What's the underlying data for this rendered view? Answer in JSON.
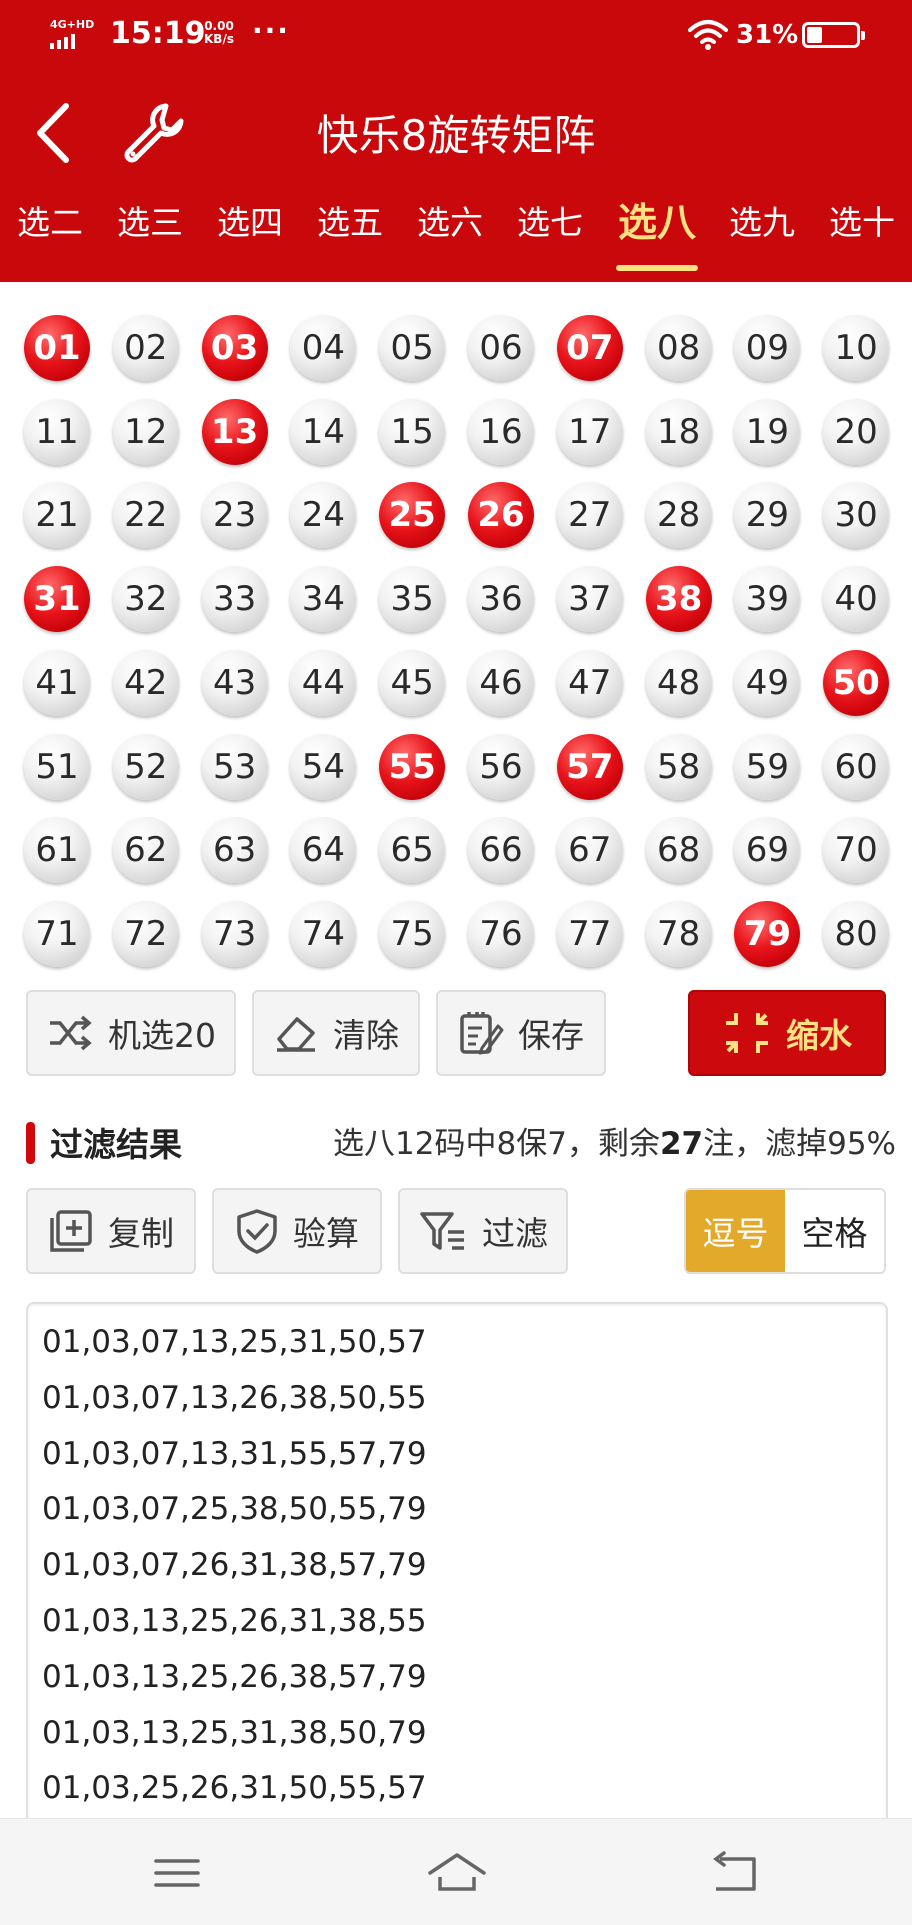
{
  "status_bar": {
    "network": "4G+HD",
    "time": "15:19",
    "speed_value": "0.00",
    "speed_unit": "KB/s",
    "more": "···",
    "battery": "31%",
    "battery_level": 0.31
  },
  "header": {
    "title": "快乐8旋转矩阵",
    "icons": [
      "back-arrow-icon",
      "wrench-icon"
    ]
  },
  "tabs": [
    {
      "label": "选二",
      "active": false
    },
    {
      "label": "选三",
      "active": false
    },
    {
      "label": "选四",
      "active": false
    },
    {
      "label": "选五",
      "active": false
    },
    {
      "label": "选六",
      "active": false
    },
    {
      "label": "选七",
      "active": false
    },
    {
      "label": "选八",
      "active": true
    },
    {
      "label": "选九",
      "active": false
    },
    {
      "label": "选十",
      "active": false
    }
  ],
  "balls": [
    "01",
    "02",
    "03",
    "04",
    "05",
    "06",
    "07",
    "08",
    "09",
    "10",
    "11",
    "12",
    "13",
    "14",
    "15",
    "16",
    "17",
    "18",
    "19",
    "20",
    "21",
    "22",
    "23",
    "24",
    "25",
    "26",
    "27",
    "28",
    "29",
    "30",
    "31",
    "32",
    "33",
    "34",
    "35",
    "36",
    "37",
    "38",
    "39",
    "40",
    "41",
    "42",
    "43",
    "44",
    "45",
    "46",
    "47",
    "48",
    "49",
    "50",
    "51",
    "52",
    "53",
    "54",
    "55",
    "56",
    "57",
    "58",
    "59",
    "60",
    "61",
    "62",
    "63",
    "64",
    "65",
    "66",
    "67",
    "68",
    "69",
    "70",
    "71",
    "72",
    "73",
    "74",
    "75",
    "76",
    "77",
    "78",
    "79",
    "80"
  ],
  "selected": [
    "01",
    "03",
    "07",
    "13",
    "25",
    "26",
    "31",
    "38",
    "50",
    "55",
    "57",
    "79"
  ],
  "actions": {
    "random": "机选20",
    "clear": "清除",
    "save": "保存",
    "shrink": "缩水"
  },
  "result": {
    "title": "过滤结果",
    "summary_prefix": "选八12码中8保7，剩余",
    "remaining": "27",
    "summary_suffix": "注，滤掉95%"
  },
  "tools": {
    "copy": "复制",
    "verify": "验算",
    "filter": "过滤"
  },
  "separator": {
    "comma": "逗号",
    "space": "空格",
    "selected": "comma"
  },
  "output_lines": [
    "01,03,07,13,25,31,50,57",
    "01,03,07,13,26,38,50,55",
    "01,03,07,13,31,55,57,79",
    "01,03,07,25,38,50,55,79",
    "01,03,07,26,31,38,57,79",
    "01,03,13,25,26,31,38,55",
    "01,03,13,25,26,38,57,79",
    "01,03,13,25,31,38,50,79",
    "01,03,25,26,31,50,55,57"
  ],
  "colors": {
    "header_red": "#c9080c",
    "accent_yellow": "#ffe082",
    "ball_red": "#e8141b",
    "toggle_gold": "#e3a92a"
  },
  "nav_icons": [
    "menu-icon",
    "home-icon",
    "back-icon"
  ]
}
